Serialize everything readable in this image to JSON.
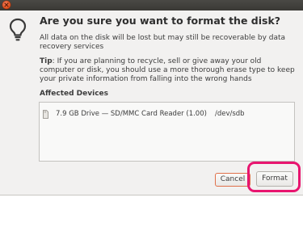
{
  "dialog": {
    "heading": "Are you sure you want to format the disk?",
    "body": "All data on the disk will be lost but may still be recoverable by data recovery services",
    "tip_label": "Tip",
    "tip_text": ": If you are planning to recycle, sell or give away your old computer or disk, you should use a more thorough erase type to keep your private information from falling into the wrong hands",
    "affected_label": "Affected Devices",
    "devices": [
      {
        "name": "7.9 GB Drive — SD/MMC Card  Reader (1.00)",
        "path": "/dev/sdb"
      }
    ],
    "buttons": {
      "cancel": "Cancel",
      "format": "Format"
    }
  },
  "colors": {
    "close": "#df4b16",
    "highlight": "#e8156f",
    "cancel_border": "#e0704a"
  },
  "icons": {
    "close": "close-icon",
    "dialog": "lightbulb-icon",
    "device": "sd-card-icon"
  }
}
